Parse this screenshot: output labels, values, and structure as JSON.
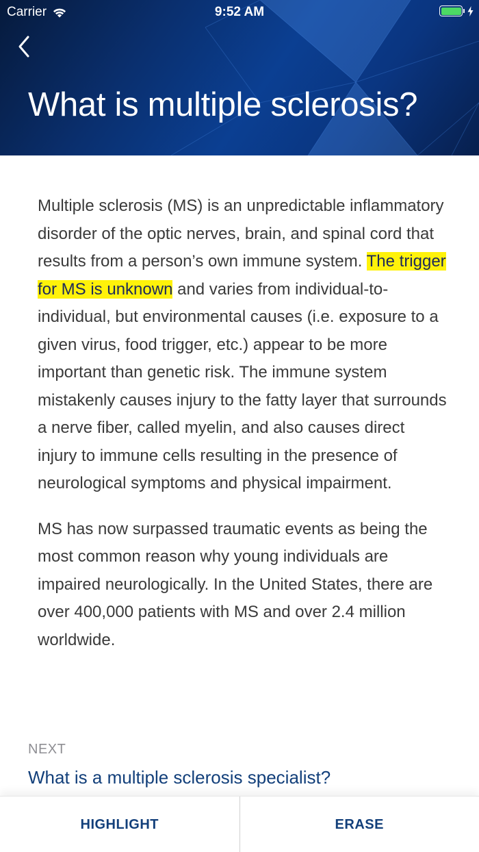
{
  "status_bar": {
    "carrier": "Carrier",
    "time": "9:52 AM",
    "battery_color": "#4cd964"
  },
  "header": {
    "back_icon": "chevron-left-icon",
    "title": "What is multiple sclerosis?"
  },
  "article": {
    "paragraph1_before": "Multiple sclerosis (MS) is an unpredictable inflammatory disorder of the optic nerves, brain, and spinal cord that results from a person’s own immune system. ",
    "paragraph1_highlight": "The trigger for MS is unknown",
    "paragraph1_after": " and varies from individual-to-individual, but environmental causes (i.e. exposure to a given virus, food trigger, etc.) appear to be more important than genetic risk. The immune system mistakenly causes injury to the fatty layer that surrounds a nerve fiber, called myelin, and also causes direct injury to immune cells resulting in the presence of neurological symptoms and physical impairment.",
    "paragraph2": "MS has now surpassed traumatic events as being the most common reason why young individuals are impaired neurologically. In the United States, there are over 400,000 patients with MS and over 2.4 million worldwide."
  },
  "next": {
    "label": "NEXT",
    "link": "What is a multiple sclerosis specialist?"
  },
  "toolbar": {
    "highlight_label": "HIGHLIGHT",
    "erase_label": "ERASE"
  },
  "colors": {
    "header_dark": "#061a3c",
    "header_blue": "#0b3f92",
    "highlight": "#fff20a",
    "link": "#123f7a"
  }
}
